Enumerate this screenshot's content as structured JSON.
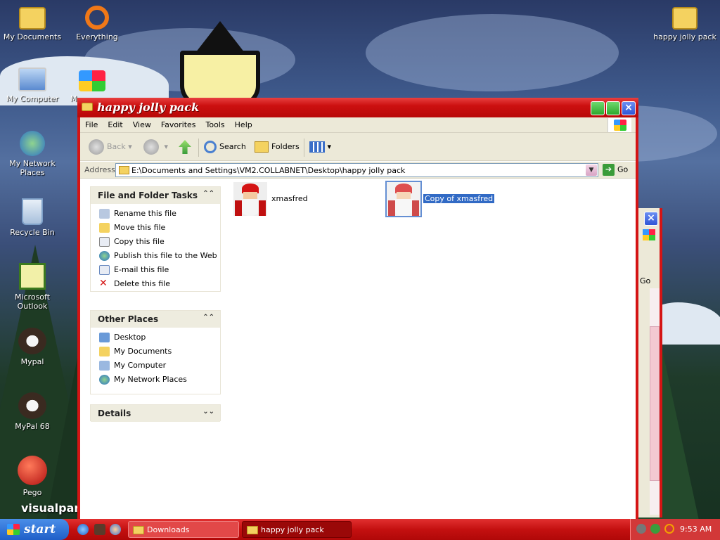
{
  "desktop": {
    "icons": [
      {
        "label": "My Documents"
      },
      {
        "label": "Everything"
      },
      {
        "label": "My Computer"
      },
      {
        "label": "M"
      },
      {
        "label": "My Network Places"
      },
      {
        "label": "Recycle Bin"
      },
      {
        "label": "Microsoft Outlook"
      },
      {
        "label": "Mypal"
      },
      {
        "label": "MyPal 68"
      },
      {
        "label": "Pego"
      },
      {
        "label": "happy jolly pack"
      }
    ],
    "wallpaper_text": "visualpar"
  },
  "window": {
    "title": "happy jolly pack",
    "menu": [
      "File",
      "Edit",
      "View",
      "Favorites",
      "Tools",
      "Help"
    ],
    "toolbar": {
      "back": "Back",
      "search": "Search",
      "folders": "Folders"
    },
    "address": {
      "label": "Address",
      "path": "E:\\Documents and Settings\\VM2.COLLABNET\\Desktop\\happy jolly pack",
      "go": "Go"
    },
    "tasks_panel": {
      "title": "File and Folder Tasks",
      "items": [
        "Rename this file",
        "Move this file",
        "Copy this file",
        "Publish this file to the Web",
        "E-mail this file",
        "Delete this file"
      ]
    },
    "places_panel": {
      "title": "Other Places",
      "items": [
        "Desktop",
        "My Documents",
        "My Computer",
        "My Network Places"
      ]
    },
    "details_panel": {
      "title": "Details"
    },
    "files": [
      {
        "name": "xmasfred",
        "selected": false
      },
      {
        "name": "Copy of xmasfred",
        "selected": true
      }
    ]
  },
  "background_window": {
    "go": "Go"
  },
  "taskbar": {
    "start": "start",
    "tasks": [
      "Downloads",
      "happy jolly pack"
    ],
    "clock": "9:53 AM"
  },
  "colors": {
    "titlebar": "#cc1010",
    "taskbar": "#c41010",
    "selection": "#316ac5"
  }
}
